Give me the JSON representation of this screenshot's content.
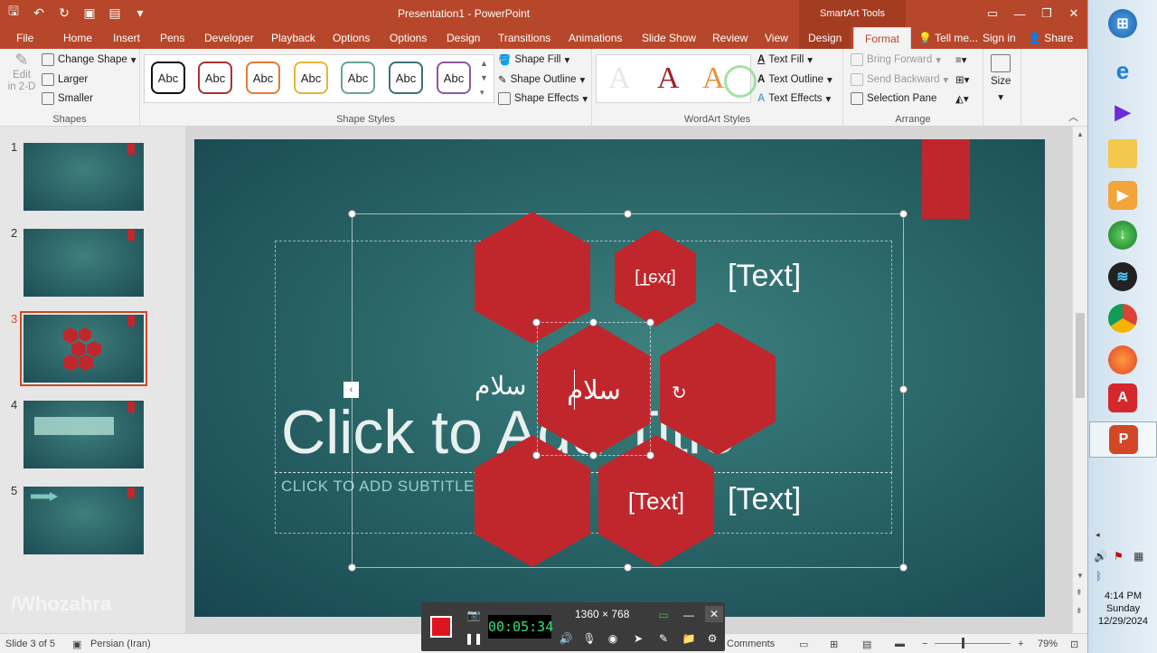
{
  "titlebar": {
    "title": "Presentation1 - PowerPoint",
    "context_tools": "SmartArt Tools"
  },
  "tabs": [
    "File",
    "Home",
    "Insert",
    "Pens",
    "Developer",
    "Playback",
    "Options",
    "Options",
    "Design",
    "Transitions",
    "Animations",
    "Slide Show",
    "Review",
    "View",
    "Design",
    "Format"
  ],
  "tabs_right": {
    "tell_me": "Tell me...",
    "sign_in": "Sign in",
    "share": "Share"
  },
  "ribbon": {
    "shapes": {
      "edit_2d": "Edit\nin 2-D",
      "change_shape": "Change Shape",
      "larger": "Larger",
      "smaller": "Smaller",
      "label": "Shapes"
    },
    "shape_styles": {
      "abc": [
        "Abc",
        "Abc",
        "Abc",
        "Abc",
        "Abc",
        "Abc",
        "Abc"
      ],
      "fill": "Shape Fill",
      "outline": "Shape Outline",
      "effects": "Shape Effects",
      "label": "Shape Styles"
    },
    "wordart": {
      "letters": [
        "A",
        "A",
        "A"
      ],
      "text_fill": "Text Fill",
      "text_outline": "Text Outline",
      "text_effects": "Text Effects",
      "label": "WordArt Styles"
    },
    "arrange": {
      "bring_forward": "Bring Forward",
      "send_backward": "Send Backward",
      "selection_pane": "Selection Pane",
      "label": "Arrange"
    },
    "size": {
      "label": "Size"
    }
  },
  "slides": [
    {
      "num": "1"
    },
    {
      "num": "2"
    },
    {
      "num": "3"
    },
    {
      "num": "4"
    },
    {
      "num": "5"
    }
  ],
  "slide": {
    "title_placeholder": "Click to Add Title",
    "subtitle_placeholder": "CLICK TO ADD SUBTITLE",
    "hexagons": [
      {
        "text": ""
      },
      {
        "text": "[Text]"
      },
      {
        "text": "سلام"
      },
      {
        "text": ""
      },
      {
        "text": ""
      },
      {
        "text": "[Text]"
      }
    ],
    "side_text_1": "[Text]",
    "side_text_2": "[Text]",
    "floating_text": "سلام"
  },
  "recorder": {
    "timer": "00:05:34",
    "resolution": "1360 × 768"
  },
  "statusbar": {
    "slide_info": "Slide 3 of 5",
    "language": "Persian (Iran)",
    "comments": "Comments",
    "zoom": "79%"
  },
  "watermark": "/Whozahra",
  "clock": {
    "time": "4:14 PM",
    "day": "Sunday",
    "date": "12/29/2024"
  },
  "colors": {
    "ppt_orange": "#b7472a",
    "hex_red": "#c0272d",
    "slide_teal": "#2a6668"
  }
}
